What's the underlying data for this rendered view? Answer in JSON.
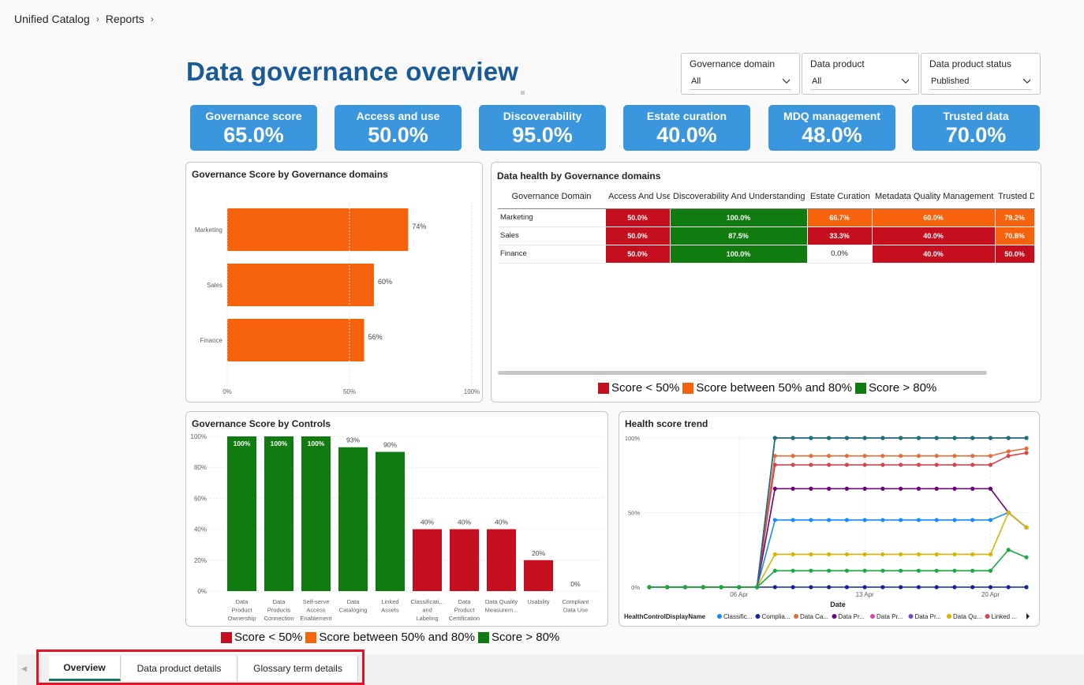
{
  "breadcrumb": [
    "Unified Catalog",
    "Reports"
  ],
  "title": "Data governance overview",
  "filters": [
    {
      "label": "Governance domain",
      "value": "All"
    },
    {
      "label": "Data product",
      "value": "All"
    },
    {
      "label": "Data product status",
      "value": "Published"
    }
  ],
  "kpis": [
    {
      "label": "Governance score",
      "value": "65.0%"
    },
    {
      "label": "Access and use",
      "value": "50.0%"
    },
    {
      "label": "Discoverability",
      "value": "95.0%"
    },
    {
      "label": "Estate curation",
      "value": "40.0%"
    },
    {
      "label": "MDQ management",
      "value": "48.0%"
    },
    {
      "label": "Trusted data",
      "value": "70.0%"
    }
  ],
  "colors": {
    "red": "#c50f1f",
    "orange": "#f7630c",
    "green": "#107c10",
    "blue": "#3a96dd"
  },
  "legend": [
    {
      "label": "Score < 50%",
      "color": "#c50f1f"
    },
    {
      "label": "Score between 50% and 80%",
      "color": "#f7630c"
    },
    {
      "label": "Score > 80%",
      "color": "#107c10"
    }
  ],
  "data_health": {
    "title": "Data health by Governance domains",
    "columns": [
      "Governance Domain",
      "Access And Use",
      "Discoverability And Understanding",
      "Estate Curation",
      "Metadata Quality Management",
      "Trusted D"
    ],
    "rows": [
      {
        "domain": "Marketing",
        "cells": [
          {
            "v": "50.0%",
            "c": "red"
          },
          {
            "v": "100.0%",
            "c": "green"
          },
          {
            "v": "66.7%",
            "c": "orange"
          },
          {
            "v": "60.0%",
            "c": "orange"
          },
          {
            "v": "79.2%",
            "c": "orange"
          }
        ]
      },
      {
        "domain": "Sales",
        "cells": [
          {
            "v": "50.0%",
            "c": "red"
          },
          {
            "v": "87.5%",
            "c": "green"
          },
          {
            "v": "33.3%",
            "c": "red"
          },
          {
            "v": "40.0%",
            "c": "red"
          },
          {
            "v": "70.8%",
            "c": "orange"
          }
        ]
      },
      {
        "domain": "Finance",
        "cells": [
          {
            "v": "50.0%",
            "c": "red"
          },
          {
            "v": "100.0%",
            "c": "green"
          },
          {
            "v": "0.0%",
            "c": "none"
          },
          {
            "v": "40.0%",
            "c": "red"
          },
          {
            "v": "50.0%",
            "c": "red"
          }
        ]
      }
    ]
  },
  "panels": {
    "domains_title": "Governance Score by Governance domains",
    "controls_title": "Governance Score by Controls",
    "trend_title": "Health score trend"
  },
  "tabs": [
    {
      "label": "Overview",
      "active": true
    },
    {
      "label": "Data product details",
      "active": false
    },
    {
      "label": "Glossary term details",
      "active": false
    }
  ],
  "chart_data": [
    {
      "type": "bar",
      "orientation": "horizontal",
      "title": "Governance Score by Governance domains",
      "categories": [
        "Marketing",
        "Sales",
        "Finance"
      ],
      "values": [
        74,
        60,
        56
      ],
      "value_labels": [
        "74%",
        "60%",
        "56%"
      ],
      "xlim": [
        0,
        100
      ],
      "xticks": [
        "0%",
        "50%",
        "100%"
      ],
      "color": "#f7630c"
    },
    {
      "type": "bar",
      "title": "Governance Score by Controls",
      "categories": [
        "Data Product Ownership",
        "Data Products Connection",
        "Self-serve Access Enablement",
        "Data Cataloging",
        "Linked Assets",
        "Classificati... and Labeling",
        "Data Product Certification",
        "Data Quality Measurem...",
        "Usability",
        "Compliant Data Use"
      ],
      "category_lines": [
        [
          "Data",
          "Product",
          "Ownership"
        ],
        [
          "Data",
          "Products",
          "Connection"
        ],
        [
          "Self-serve",
          "Access",
          "Enablement"
        ],
        [
          "Data",
          "Cataloging"
        ],
        [
          "Linked",
          "Assets"
        ],
        [
          "Classificati...",
          "and",
          "Labeling"
        ],
        [
          "Data",
          "Product",
          "Certification"
        ],
        [
          "Data Quality",
          "Measurem..."
        ],
        [
          "Usability"
        ],
        [
          "Compliant",
          "Data Use"
        ]
      ],
      "values": [
        100,
        100,
        100,
        93,
        90,
        40,
        40,
        40,
        20,
        0
      ],
      "value_labels": [
        "100%",
        "100%",
        "100%",
        "93%",
        "90%",
        "40%",
        "40%",
        "40%",
        "20%",
        "0%"
      ],
      "ylim": [
        0,
        100
      ],
      "yticks": [
        "0%",
        "20%",
        "40%",
        "60%",
        "80%",
        "100%"
      ]
    },
    {
      "type": "line",
      "title": "Health score trend",
      "xlabel": "Date",
      "xticks": [
        "06 Apr",
        "13 Apr",
        "20 Apr"
      ],
      "yticks": [
        "0%",
        "50%",
        "100%"
      ],
      "ylim": [
        0,
        100
      ],
      "legend_title": "HealthControlDisplayName",
      "legend_labels": [
        "Classific...",
        "Complia...",
        "Data Ca...",
        "Data Pr...",
        "Data Pr...",
        "Data Pr...",
        "Data Qu...",
        "Linked ..."
      ],
      "series": [
        {
          "name": "Classific...",
          "color": "#118dff",
          "values": [
            0,
            0,
            0,
            0,
            0,
            0,
            0,
            45,
            45,
            45,
            45,
            45,
            45,
            45,
            45,
            45,
            45,
            45,
            45,
            45,
            50,
            40
          ]
        },
        {
          "name": "Complia...",
          "color": "#12239e",
          "values": [
            0,
            0,
            0,
            0,
            0,
            0,
            0,
            0,
            0,
            0,
            0,
            0,
            0,
            0,
            0,
            0,
            0,
            0,
            0,
            0,
            0,
            0
          ]
        },
        {
          "name": "Data Ca...",
          "color": "#e66c37",
          "values": [
            0,
            0,
            0,
            0,
            0,
            0,
            0,
            88,
            88,
            88,
            88,
            88,
            88,
            88,
            88,
            88,
            88,
            88,
            88,
            88,
            91,
            93
          ]
        },
        {
          "name": "Data Pr...",
          "color": "#6b007b",
          "values": [
            0,
            0,
            0,
            0,
            0,
            0,
            0,
            66,
            66,
            66,
            66,
            66,
            66,
            66,
            66,
            66,
            66,
            66,
            66,
            66,
            50,
            40
          ]
        },
        {
          "name": "Data Pr...",
          "color": "#e044a7",
          "values": [
            0,
            0,
            0,
            0,
            0,
            0,
            0,
            100,
            100,
            100,
            100,
            100,
            100,
            100,
            100,
            100,
            100,
            100,
            100,
            100,
            100,
            100
          ]
        },
        {
          "name": "Data Pr...",
          "color": "#744ec2",
          "values": [
            0,
            0,
            0,
            0,
            0,
            0,
            0,
            100,
            100,
            100,
            100,
            100,
            100,
            100,
            100,
            100,
            100,
            100,
            100,
            100,
            100,
            100
          ]
        },
        {
          "name": "Data Qu...",
          "color": "#d9b300",
          "values": [
            0,
            0,
            0,
            0,
            0,
            0,
            0,
            22,
            22,
            22,
            22,
            22,
            22,
            22,
            22,
            22,
            22,
            22,
            22,
            22,
            50,
            40
          ]
        },
        {
          "name": "Linked ...",
          "color": "#d64550",
          "values": [
            0,
            0,
            0,
            0,
            0,
            0,
            0,
            82,
            82,
            82,
            82,
            82,
            82,
            82,
            82,
            82,
            82,
            82,
            82,
            82,
            88,
            90
          ]
        },
        {
          "name": "",
          "color": "#197278",
          "values": [
            0,
            0,
            0,
            0,
            0,
            0,
            0,
            100,
            100,
            100,
            100,
            100,
            100,
            100,
            100,
            100,
            100,
            100,
            100,
            100,
            100,
            100
          ]
        },
        {
          "name": "",
          "color": "#1aab40",
          "values": [
            0,
            0,
            0,
            0,
            0,
            0,
            0,
            11,
            11,
            11,
            11,
            11,
            11,
            11,
            11,
            11,
            11,
            11,
            11,
            11,
            25,
            20
          ]
        }
      ]
    }
  ]
}
